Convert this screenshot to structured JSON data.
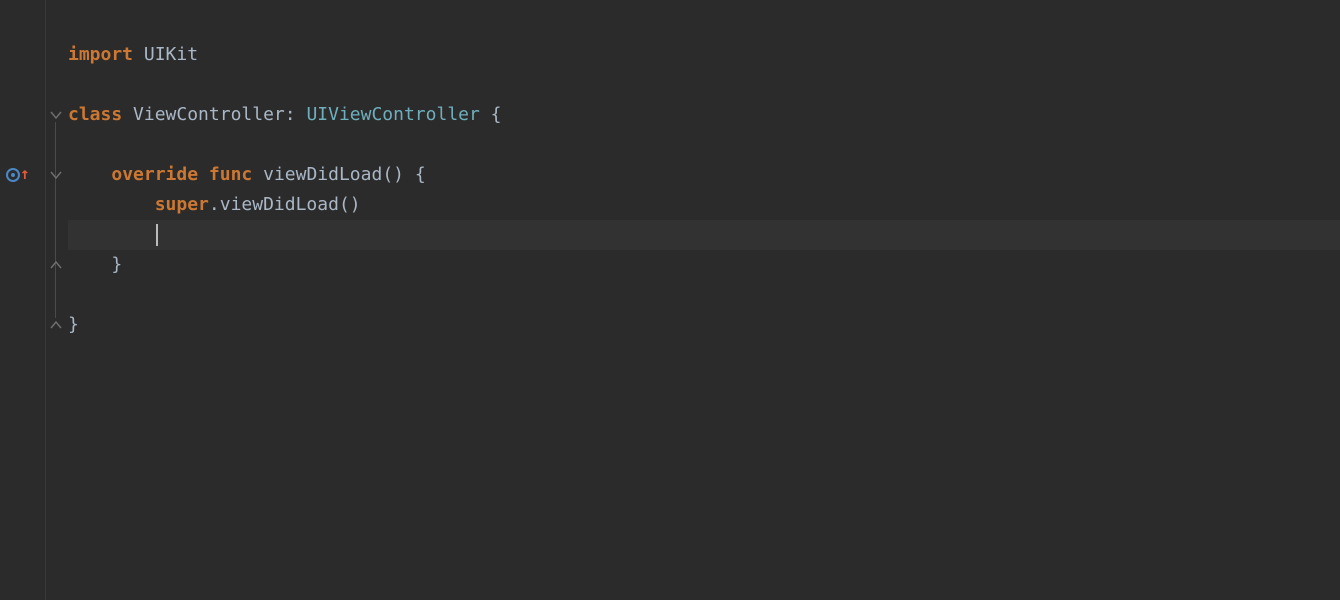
{
  "code": {
    "lines": [
      {
        "tokens": [
          {
            "t": "kw",
            "v": "import"
          },
          {
            "t": "sp",
            "v": " "
          },
          {
            "t": "cls",
            "v": "UIKit"
          }
        ],
        "indent": 0
      },
      {
        "tokens": [],
        "indent": 0
      },
      {
        "tokens": [
          {
            "t": "kw",
            "v": "class"
          },
          {
            "t": "sp",
            "v": " "
          },
          {
            "t": "cls",
            "v": "ViewController"
          },
          {
            "t": "punc",
            "v": ":"
          },
          {
            "t": "sp",
            "v": " "
          },
          {
            "t": "type",
            "v": "UIViewController"
          },
          {
            "t": "sp",
            "v": " "
          },
          {
            "t": "punc",
            "v": "{"
          }
        ],
        "indent": 0,
        "fold": "open"
      },
      {
        "tokens": [],
        "indent": 0
      },
      {
        "tokens": [
          {
            "t": "kw",
            "v": "override"
          },
          {
            "t": "sp",
            "v": " "
          },
          {
            "t": "kw",
            "v": "func"
          },
          {
            "t": "sp",
            "v": " "
          },
          {
            "t": "fn",
            "v": "viewDidLoad"
          },
          {
            "t": "punc",
            "v": "()"
          },
          {
            "t": "sp",
            "v": " "
          },
          {
            "t": "punc",
            "v": "{"
          }
        ],
        "indent": 1,
        "fold": "open",
        "breakpoint": true
      },
      {
        "tokens": [
          {
            "t": "super-kw",
            "v": "super"
          },
          {
            "t": "punc",
            "v": "."
          },
          {
            "t": "fn",
            "v": "viewDidLoad"
          },
          {
            "t": "punc",
            "v": "()"
          }
        ],
        "indent": 2
      },
      {
        "tokens": [],
        "indent": 2,
        "current": true,
        "caret": true
      },
      {
        "tokens": [
          {
            "t": "punc",
            "v": "}"
          }
        ],
        "indent": 1,
        "fold": "close"
      },
      {
        "tokens": [],
        "indent": 0
      },
      {
        "tokens": [
          {
            "t": "punc",
            "v": "}"
          }
        ],
        "indent": 0,
        "fold": "close"
      }
    ]
  },
  "gutter": {
    "breakpoint_line_index": 4
  },
  "colors": {
    "bg": "#2b2b2b",
    "keyword": "#cc7832",
    "identifier": "#a9b7c6",
    "type": "#6fafbd",
    "current_line": "#323232"
  }
}
